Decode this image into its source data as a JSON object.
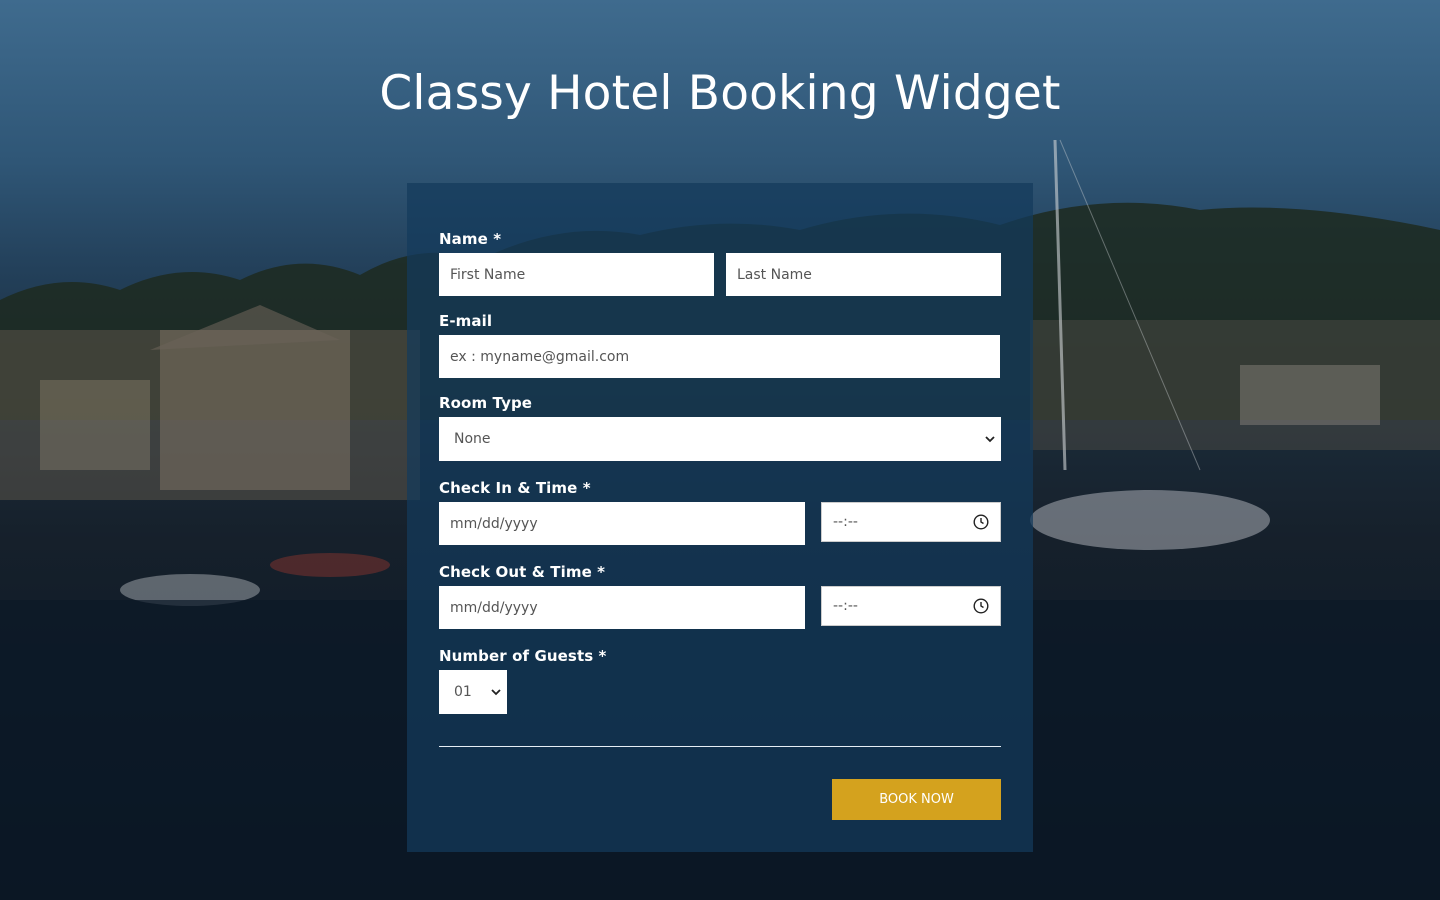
{
  "title": "Classy Hotel Booking Widget",
  "form": {
    "name_label": "Name *",
    "first_name_placeholder": "First Name",
    "last_name_placeholder": "Last Name",
    "email_label": "E-mail",
    "email_placeholder": "ex : myname@gmail.com",
    "room_type_label": "Room Type",
    "room_type_value": "None",
    "checkin_label": "Check In & Time *",
    "checkin_date_placeholder": "mm/dd/yyyy",
    "checkin_time_placeholder": "--:--",
    "checkout_label": "Check Out & Time *",
    "checkout_date_placeholder": "mm/dd/yyyy",
    "checkout_time_placeholder": "--:--",
    "guests_label": "Number of Guests *",
    "guests_value": "01",
    "book_button": "BOOK NOW"
  },
  "colors": {
    "button": "#d4a21e",
    "card": "rgba(20,58,92,0.72)"
  },
  "icons": {
    "select_arrow": "chevron-down-icon",
    "time": "clock-icon"
  }
}
